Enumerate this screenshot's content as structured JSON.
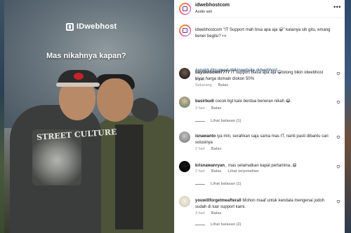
{
  "post": {
    "brand_text": "IDwebhost",
    "overlay_caption": "Mas nikahnya kapan?",
    "print_text": "STREET CULTURE"
  },
  "header": {
    "username": "idwebhostcom",
    "subtitle": "Audio asli",
    "more_icon": "more-horizontal-icon"
  },
  "caption": {
    "text": "idwebhostcom \"IT Support mah bisa apa aja 😀\" katanya sih gitu, emang bener begitu? 👀",
    "hashtags": "#anakit #itsupport #bikinwebsite #idwebhost",
    "time": "3 hari"
  },
  "comments": [
    {
      "user": "bayuwibowo7777",
      "text": "IT support biasa apa aja 😁tolong bikin idwebhost biyar harga domain diskon 50%",
      "time": "Sekarang",
      "reply": "Balas"
    },
    {
      "user": "basirbudi",
      "text": "cocok bgt kalo berdua beneran nikah 😂",
      "time": "3 hari",
      "reply": "Balas",
      "view_replies": "Lihat balasan (1)"
    },
    {
      "user": "isnawanto",
      "text": "iya min, serahkan saja sama mas IT, nanti pasti dibantu cari solusinya",
      "time": "2 hari",
      "reply": "Balas"
    },
    {
      "user": "krisnawanryan_",
      "text": "mas selamatkan kapal pertamina..😆",
      "time": "2 hari",
      "reply": "Balas",
      "translate": "Lihat terjemahan",
      "view_replies": "Lihat balasan (1)"
    },
    {
      "user": "youwillforgetmeafterall",
      "text": "Mohon maaf untuk kendala mengenai jodoh sudah di luar support kami.",
      "time": "3 hari",
      "reply": "Balas",
      "view_replies": "Lihat balasan (2)"
    }
  ],
  "colors": {
    "text": "#262626",
    "muted": "#8e8e8e",
    "hashtag": "#00376b",
    "divider": "#efefef"
  }
}
